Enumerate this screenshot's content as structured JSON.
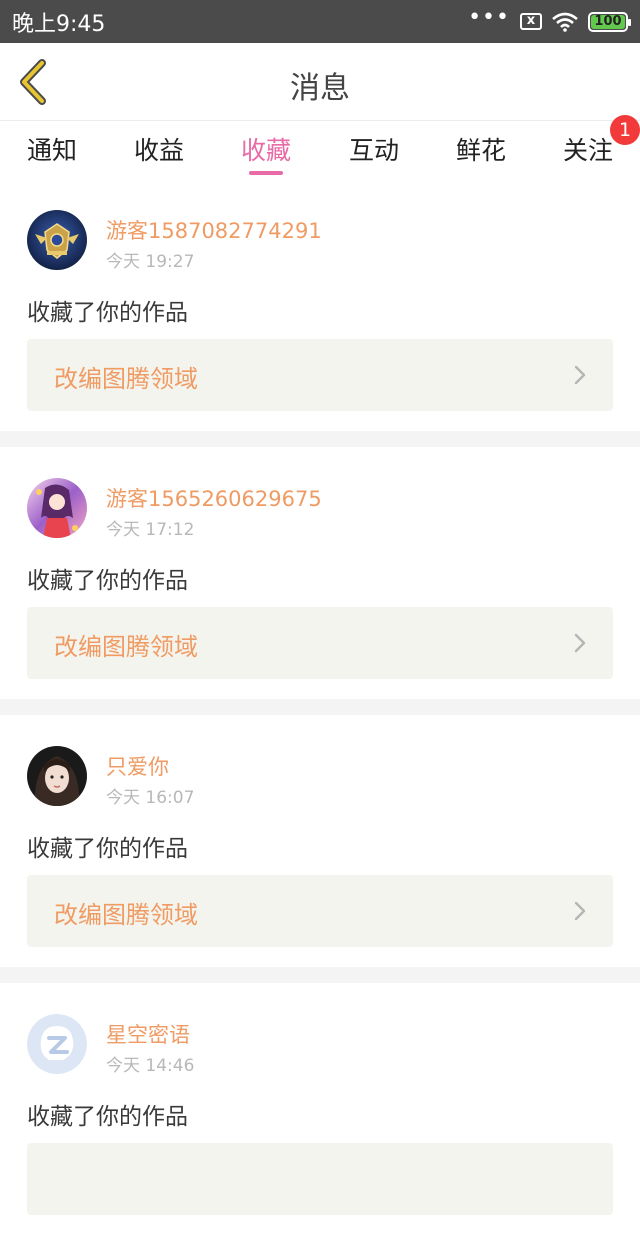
{
  "status_bar": {
    "time": "晚上9:45",
    "dots": "•••",
    "sim_label": "x",
    "battery": "100"
  },
  "header": {
    "title": "消息",
    "back_icon": "chevron-left-icon",
    "accent_color": "#e8c530"
  },
  "tabs": [
    {
      "label": "通知",
      "active": false
    },
    {
      "label": "收益",
      "active": false
    },
    {
      "label": "收藏",
      "active": true
    },
    {
      "label": "互动",
      "active": false
    },
    {
      "label": "鲜花",
      "active": false
    },
    {
      "label": "关注",
      "active": false,
      "badge": "1"
    }
  ],
  "colors": {
    "accent": "#e86aa6",
    "username": "#ef9b63",
    "badge": "#f23a3a"
  },
  "messages": [
    {
      "username": "游客1587082774291",
      "time": "今天 19:27",
      "action": "收藏了你的作品",
      "work": "改编图腾领域",
      "avatar": "game-emblem-avatar"
    },
    {
      "username": "游客1565260629675",
      "time": "今天 17:12",
      "action": "收藏了你的作品",
      "work": "改编图腾领域",
      "avatar": "anime-girl-avatar"
    },
    {
      "username": "只爱你",
      "time": "今天 16:07",
      "action": "收藏了你的作品",
      "work": "改编图腾领域",
      "avatar": "portrait-avatar"
    },
    {
      "username": "星空密语",
      "time": "今天 14:46",
      "action": "收藏了你的作品",
      "work": "",
      "avatar": "default-avatar"
    }
  ]
}
